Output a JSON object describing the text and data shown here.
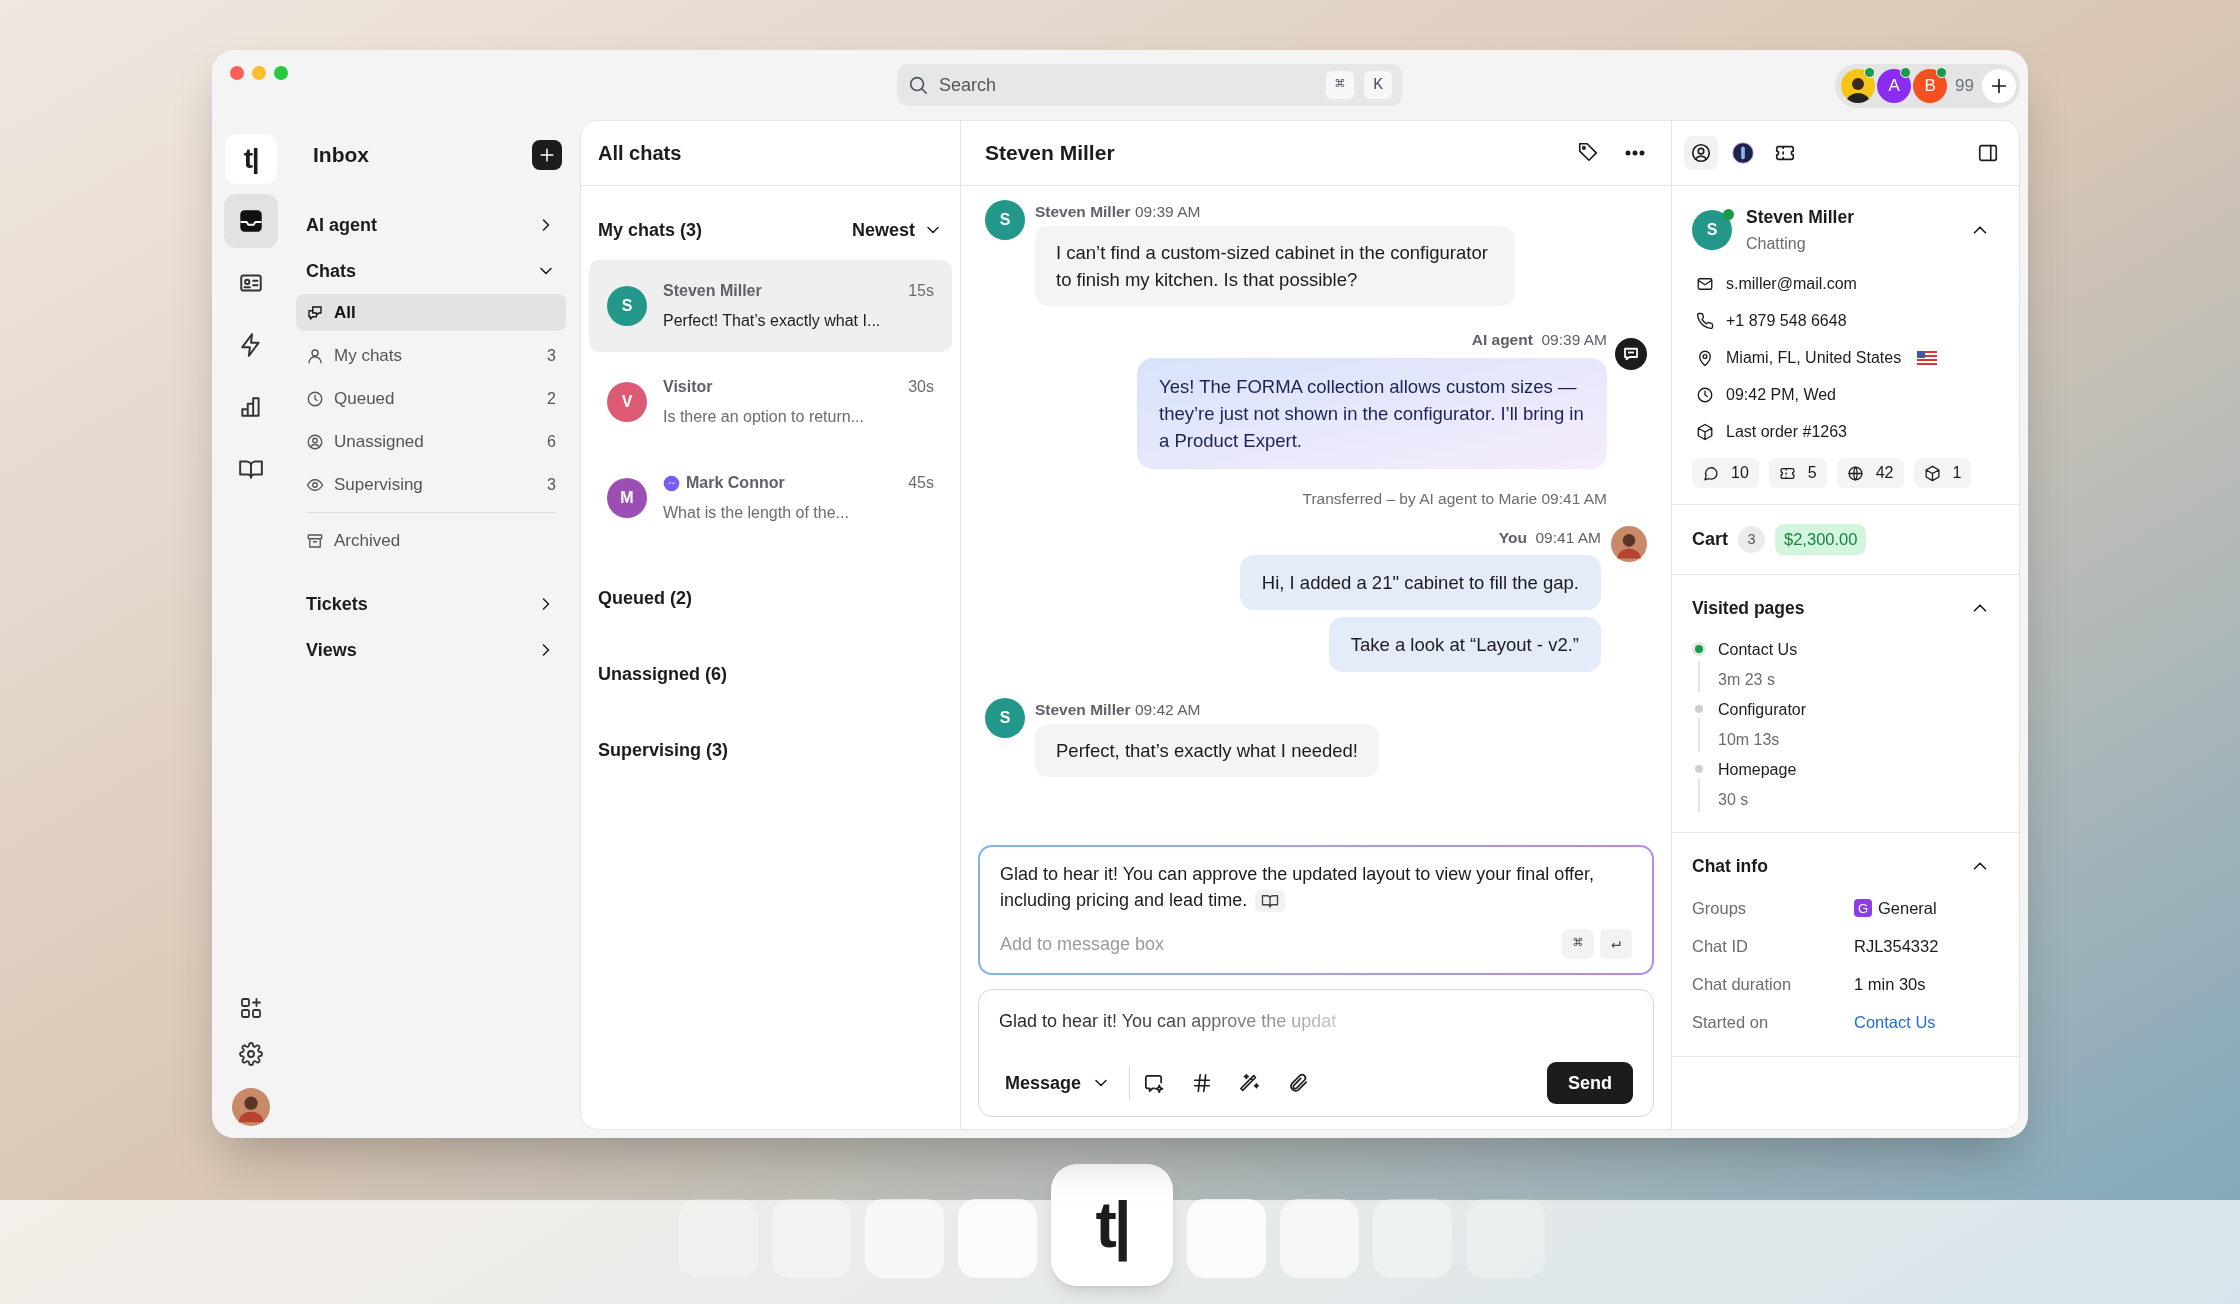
{
  "search": {
    "placeholder": "Search",
    "keys": [
      "⌘",
      "K"
    ]
  },
  "presence": {
    "avatars": [
      {
        "kind": "photo",
        "color": "#f5c518",
        "online": true
      },
      {
        "kind": "initial",
        "initial": "A",
        "color": "#8b2cf5",
        "online": true
      },
      {
        "kind": "initial",
        "initial": "B",
        "color": "#f4511e",
        "online": true
      }
    ],
    "count": "99"
  },
  "rail": {
    "logo": "t|",
    "items": [
      {
        "kind": "inbox",
        "selected": true
      },
      {
        "kind": "contacts",
        "selected": false
      },
      {
        "kind": "automation",
        "selected": false
      },
      {
        "kind": "reports",
        "selected": false
      },
      {
        "kind": "knowledge",
        "selected": false
      }
    ]
  },
  "sidebar": {
    "title": "Inbox",
    "sections": [
      {
        "label": "AI agent",
        "expanded": false
      },
      {
        "label": "Chats",
        "expanded": true,
        "children": [
          {
            "kind": "all",
            "label": "All",
            "selected": true
          },
          {
            "kind": "mine",
            "label": "My chats",
            "count": "3",
            "selected": false
          },
          {
            "kind": "queued",
            "label": "Queued",
            "count": "2",
            "selected": false
          },
          {
            "kind": "unassigned",
            "label": "Unassigned",
            "count": "6",
            "selected": false
          },
          {
            "kind": "supervising",
            "label": "Supervising",
            "count": "3",
            "selected": false
          },
          {
            "kind": "archived",
            "label": "Archived",
            "selected": false
          }
        ]
      },
      {
        "label": "Tickets",
        "expanded": false
      },
      {
        "label": "Views",
        "expanded": false
      }
    ]
  },
  "chat_list": {
    "title": "All chats",
    "groups": [
      {
        "label": "My chats (3)",
        "sort": "Newest",
        "chats": [
          {
            "kind": "web",
            "initial": "S",
            "color": "#23988a",
            "name": "Steven Miller",
            "time": "15s",
            "preview": "Perfect! That’s exactly what I...",
            "selected": true
          },
          {
            "kind": "web",
            "initial": "V",
            "color": "#dc5a73",
            "name": "Visitor",
            "time": "30s",
            "preview": "Is there an option to return...",
            "selected": false
          },
          {
            "kind": "messenger",
            "initial": "M",
            "color": "#9b4fb5",
            "name": "Mark Connor",
            "time": "45s",
            "preview": "What is the length of the...",
            "selected": false
          }
        ]
      },
      {
        "label": "Queued (2)"
      },
      {
        "label": "Unassigned (6)"
      },
      {
        "label": "Supervising (3)"
      }
    ]
  },
  "conversation": {
    "title": "Steven Miller",
    "messages": [
      {
        "kind": "customer",
        "initial": "S",
        "color": "#23988a",
        "author": "Steven Miller",
        "time": "09:39 AM",
        "bubbles": [
          "I can’t find a custom-sized cabinet in the configurator to finish my kitchen. Is that possible?"
        ]
      },
      {
        "kind": "bot",
        "author": "AI agent",
        "time": "09:39 AM",
        "bubbles": [
          "Yes! The FORMA collection allows custom sizes — they’re just not shown in the configurator. I’ll bring in a Product Expert."
        ]
      },
      {
        "kind": "system",
        "text": "Transferred – by AI agent to Marie 09:41 AM"
      },
      {
        "kind": "agent",
        "author": "You",
        "time": "09:41 AM",
        "bubbles": [
          "Hi, I added a 21\" cabinet to fill the gap.",
          "Take a look at “Layout - v2.”"
        ]
      },
      {
        "kind": "customer",
        "initial": "S",
        "color": "#23988a",
        "author": "Steven Miller",
        "time": "09:42 AM",
        "bubbles": [
          "Perfect, that’s exactly what I needed!"
        ]
      }
    ],
    "suggestion": {
      "text": "Glad to hear it! You can approve the updated layout to view your final offer, including pricing and lead time.",
      "placeholder": "Add to message box",
      "keys": [
        "⌘",
        "↵"
      ]
    },
    "composer": {
      "value": "Glad to hear it! You can approve the updat",
      "mode": "Message",
      "send": "Send"
    }
  },
  "details": {
    "tabs": [
      {
        "kind": "contact",
        "selected": true
      },
      {
        "kind": "copilot",
        "selected": false
      },
      {
        "kind": "ticket",
        "selected": false
      }
    ],
    "customer": {
      "initial": "S",
      "color": "#23988a",
      "online": true,
      "name": "Steven Miller",
      "status": "Chatting",
      "expanded": true,
      "fields": [
        {
          "kind": "email",
          "text": "s.miller@mail.com"
        },
        {
          "kind": "phone",
          "text": "+1 879 548 6648"
        },
        {
          "kind": "location",
          "text": "Miami, FL, United States"
        },
        {
          "kind": "time",
          "text": "09:42 PM, Wed"
        },
        {
          "kind": "order",
          "text": "Last order #1263"
        }
      ],
      "stats": [
        {
          "kind": "chats",
          "value": "10"
        },
        {
          "kind": "tickets",
          "value": "5"
        },
        {
          "kind": "visits",
          "value": "42"
        },
        {
          "kind": "orders",
          "value": "1"
        }
      ]
    },
    "cart": {
      "label": "Cart",
      "count": "3",
      "total": "$2,300.00"
    },
    "visited": {
      "title": "Visited pages",
      "expanded": true,
      "pages": [
        {
          "name": "Contact Us",
          "duration": "3m 23 s",
          "current": true
        },
        {
          "name": "Configurator",
          "duration": "10m 13s",
          "current": false
        },
        {
          "name": "Homepage",
          "duration": "30 s",
          "current": false
        }
      ]
    },
    "chat_info": {
      "title": "Chat info",
      "expanded": true,
      "rows": [
        {
          "kind": "group",
          "label": "Groups",
          "badge": "G",
          "color": "#8e3ee0",
          "value": "General"
        },
        {
          "kind": "text",
          "label": "Chat ID",
          "value": "RJL354332"
        },
        {
          "kind": "text",
          "label": "Chat duration",
          "value": "1 min 30s"
        },
        {
          "kind": "link",
          "label": "Started on",
          "value": "Contact Us"
        }
      ]
    }
  },
  "dock": {
    "logo": "t|"
  }
}
